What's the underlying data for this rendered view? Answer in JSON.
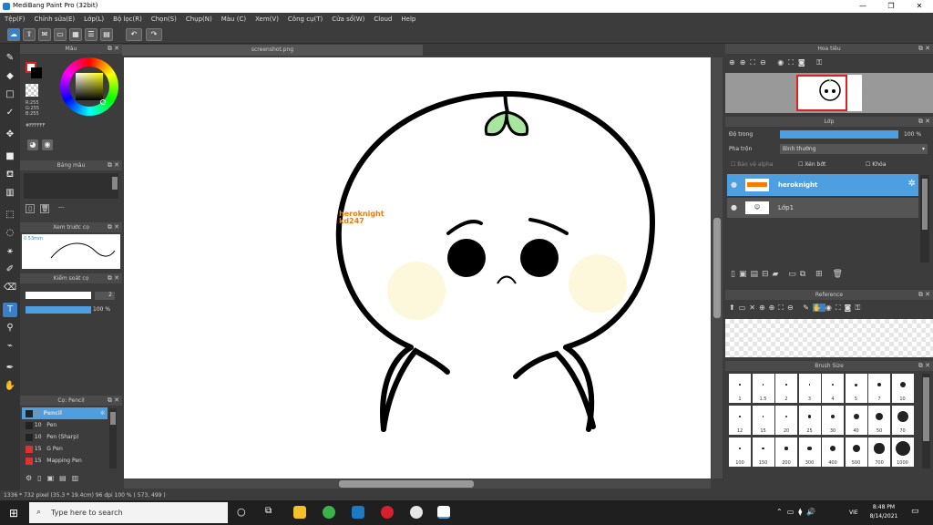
{
  "window": {
    "title": "MediBang Paint Pro (32bit)",
    "min": "—",
    "max": "❐",
    "close": "✕"
  },
  "menu": [
    "Tệp(F)",
    "Chỉnh sửa(E)",
    "Lớp(L)",
    "Bộ lọc(R)",
    "Chọn(S)",
    "Chụp(N)",
    "Màu (C)",
    "Xem(V)",
    "Công cụ(T)",
    "Cửa sổ(W)",
    "Cloud",
    "Help"
  ],
  "color_panel": {
    "title": "Màu",
    "r": "R:255",
    "g": "G:255",
    "b": "B:255",
    "hex": "#FFFFFF"
  },
  "palette_panel": {
    "title": "Bảng màu",
    "dash": "---"
  },
  "brush_preview": {
    "title": "Xem trước cọ",
    "size": "0.53mm"
  },
  "brush_control": {
    "title": "Kiểm soát cọ",
    "size": "2",
    "opacity": "100 %"
  },
  "brush_list": {
    "title": "Cọ: Pencil",
    "items": [
      {
        "size": "2",
        "name": "Pencil",
        "color": "#222"
      },
      {
        "size": "10",
        "name": "Pen",
        "color": "#222"
      },
      {
        "size": "10",
        "name": "Pen (Sharp)",
        "color": "#222"
      },
      {
        "size": "15",
        "name": "G Pen",
        "color": "#e03030"
      },
      {
        "size": "15",
        "name": "Mapping Pen",
        "color": "#e03030"
      }
    ]
  },
  "document": {
    "tab": "screenshot.png",
    "watermark_line1": "heroknight",
    "watermark_line2": "kd247"
  },
  "navigator": {
    "title": "Hoa tiêu"
  },
  "layers": {
    "title": "Lớp",
    "opacity_label": "Độ trong",
    "opacity_value": "100 %",
    "blend_label": "Pha trộn",
    "blend_value": "Bình thường",
    "protect_alpha": "Bảo vệ alpha",
    "clip": "Xén bớt",
    "lock": "Khóa",
    "items": [
      {
        "name": "heroknight",
        "selected": true
      },
      {
        "name": "Lớp1",
        "selected": false
      }
    ]
  },
  "reference": {
    "title": "Reference"
  },
  "brush_size": {
    "title": "Brush Size",
    "row1": [
      "1",
      "1.5",
      "2",
      "3",
      "4",
      "5",
      "7",
      "10"
    ],
    "row2": [
      "12",
      "15",
      "20",
      "25",
      "30",
      "40",
      "50",
      "70"
    ],
    "row3": [
      "100",
      "150",
      "200",
      "300",
      "400",
      "500",
      "700",
      "1000"
    ]
  },
  "status": {
    "text": "1336 * 732 pixel  (35.3 * 19.4cm)  96 dpi  100 %  ( 573, 499 )"
  },
  "taskbar": {
    "search": "Type here to search",
    "lang": "VIE",
    "time": "8:48 PM",
    "date": "8/14/2021"
  },
  "colors": {
    "accent": "#4d9fe0",
    "pencil_orange": "#f57c00",
    "sprout": "#a8e6a0",
    "blush": "#fdf8dc"
  }
}
